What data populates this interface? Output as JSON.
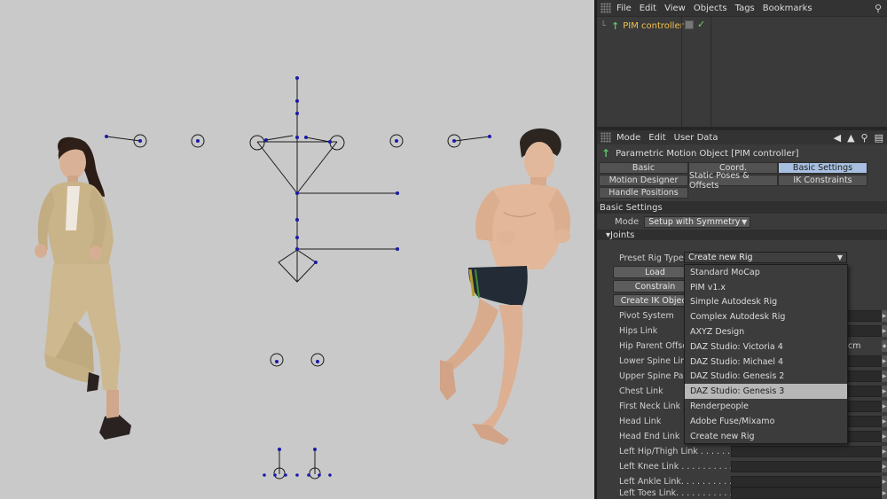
{
  "menubar": {
    "items": [
      "File",
      "Edit",
      "View",
      "Objects",
      "Tags",
      "Bookmarks"
    ],
    "search_icon": "search-icon"
  },
  "object_manager": {
    "object_name": "PIM controller",
    "object_icon": "green-arrow-icon",
    "tag_check": "✓"
  },
  "attribute_manager": {
    "menu": [
      "Mode",
      "Edit",
      "User Data"
    ],
    "title": "Parametric Motion Object [PIM controller]",
    "tabs": [
      "Basic",
      "Coord.",
      "Basic Settings",
      "Motion Designer",
      "Static Poses & Offsets",
      "IK Constraints",
      "Handle Positions"
    ],
    "active_tab": "Basic Settings",
    "section": "Basic Settings",
    "mode_label": "Mode",
    "mode_value": "Setup with Symmetry",
    "joints_label": "▾Joints",
    "preset_label": "Preset Rig Types",
    "preset_value": "Create new Rig",
    "buttons": {
      "load": "Load",
      "constrain": "Constrain",
      "create_ik": "Create IK Object"
    },
    "properties": [
      "Pivot System",
      "Hips Link",
      "Hip Parent Offse",
      "Lower Spine Link",
      "Upper Spine Pare",
      "Chest Link",
      "First Neck Link",
      "Head Link",
      "Head End Link",
      "Left Hip/Thigh Link . . . . . . . .",
      "Left Knee Link . . . . . . . . . . .",
      "Left Ankle Link. . . . . . . . . . .",
      "Left Toes Link. . . . . . . . . . . ."
    ],
    "unit": "cm"
  },
  "dropdown": {
    "options": [
      "Standard MoCap",
      "PIM v1.x",
      "Simple Autodesk Rig",
      "Complex Autodesk Rig",
      "AXYZ Design",
      "DAZ Studio: Victoria 4",
      "DAZ Studio: Michael 4",
      "DAZ Studio: Genesis 2",
      "DAZ Studio: Genesis 3",
      "Renderpeople",
      "Adobe Fuse/Mixamo",
      "Create new Rig"
    ],
    "highlighted": "DAZ Studio: Genesis 3"
  },
  "colors": {
    "viewport_bg": "#c9c9c9",
    "panel_bg": "#3b3b3b",
    "active_tab": "#a7bfe0",
    "object_name": "#f1c04a",
    "handle_blue": "#1a1aa8"
  }
}
